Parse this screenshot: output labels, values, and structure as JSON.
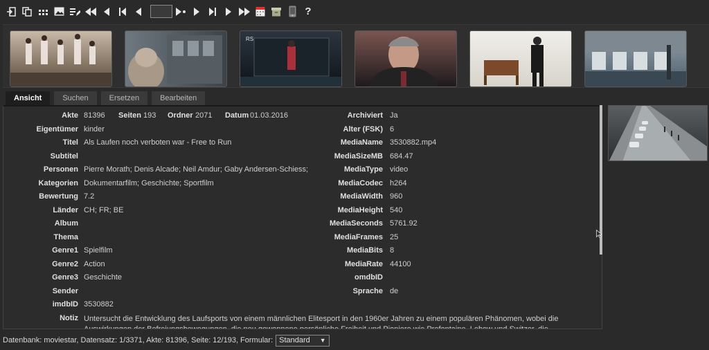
{
  "toolbar": {
    "record_input": "",
    "help_label": "?"
  },
  "thumbnails": [
    {
      "name": "thumb-runners",
      "c1": "#c9b9a8",
      "c2": "#5a4a3a"
    },
    {
      "name": "thumb-train",
      "c1": "#6f7880",
      "c2": "#3c4349"
    },
    {
      "name": "thumb-stage",
      "c1": "#2b3540",
      "c2": "#0f1418"
    },
    {
      "name": "thumb-speaker",
      "c1": "#7a5550",
      "c2": "#1f1a1c"
    },
    {
      "name": "thumb-gallery",
      "c1": "#f0eeea",
      "c2": "#d8d4cc"
    },
    {
      "name": "thumb-hall",
      "c1": "#9aa5ad",
      "c2": "#4b5c6a"
    }
  ],
  "tabs": [
    "Ansicht",
    "Suchen",
    "Ersetzen",
    "Bearbeiten"
  ],
  "record": {
    "akte_label": "Akte",
    "akte": "81396",
    "seiten_label": "Seiten",
    "seiten": "193",
    "ordner_label": "Ordner",
    "ordner": "2071",
    "datum_label": "Datum",
    "datum": "01.03.2016",
    "eigentuemer_label": "Eigentümer",
    "eigentuemer": "kinder",
    "titel_label": "Titel",
    "titel": "Als Laufen noch verboten war - Free to Run",
    "subtitel_label": "Subtitel",
    "subtitel": "",
    "personen_label": "Personen",
    "personen": "Pierre Morath; Denis Alcade; Neil Amdur; Gaby Andersen-Schiess;",
    "kategorien_label": "Kategorien",
    "kategorien": "Dokumentarfilm; Geschichte; Sportfilm",
    "bewertung_label": "Bewertung",
    "bewertung": "7.2",
    "laender_label": "Länder",
    "laender": "CH; FR; BE",
    "album_label": "Album",
    "album": "",
    "thema_label": "Thema",
    "thema": "",
    "genre1_label": "Genre1",
    "genre1": "Spielfilm",
    "genre2_label": "Genre2",
    "genre2": "Action",
    "genre3_label": "Genre3",
    "genre3": "Geschichte",
    "sender_label": "Sender",
    "sender": "",
    "imdbid_label": "imdbID",
    "imdbid": "3530882",
    "notiz_label": "Notiz",
    "notiz": "Untersucht die Entwicklung des Laufsports von einem männlichen Elitesport in den 1960er Jahren zu einem populären Phänomen, wobei die Auswirkungen der Befreiungsbewegungen, die neu gewonnene persönliche Freiheit und Pioniere wie Prefontaine, Lebow und Switzer, die",
    "archiviert_label": "Archiviert",
    "archiviert": "Ja",
    "alter_label": "Alter (FSK)",
    "alter": "6",
    "medianame_label": "MediaName",
    "medianame": "3530882.mp4",
    "mediasize_label": "MediaSizeMB",
    "mediasize": "684.47",
    "mediatype_label": "MediaType",
    "mediatype": "video",
    "mediacodec_label": "MediaCodec",
    "mediacodec": "h264",
    "mediawidth_label": "MediaWidth",
    "mediawidth": "960",
    "mediaheight_label": "MediaHeight",
    "mediaheight": "540",
    "mediaseconds_label": "MediaSeconds",
    "mediaseconds": "5761.92",
    "mediaframes_label": "MediaFrames",
    "mediaframes": "25",
    "mediabits_label": "MediaBits",
    "mediabits": "8",
    "mediarate_label": "MediaRate",
    "mediarate": "44100",
    "omdbid_label": "omdbID",
    "omdbid": "",
    "sprache_label": "Sprache",
    "sprache": "de"
  },
  "status": {
    "text": "Datenbank: moviestar, Datensatz: 1/3371, Akte: 81396, Seite: 12/193, Formular:",
    "formular": "Standard"
  }
}
